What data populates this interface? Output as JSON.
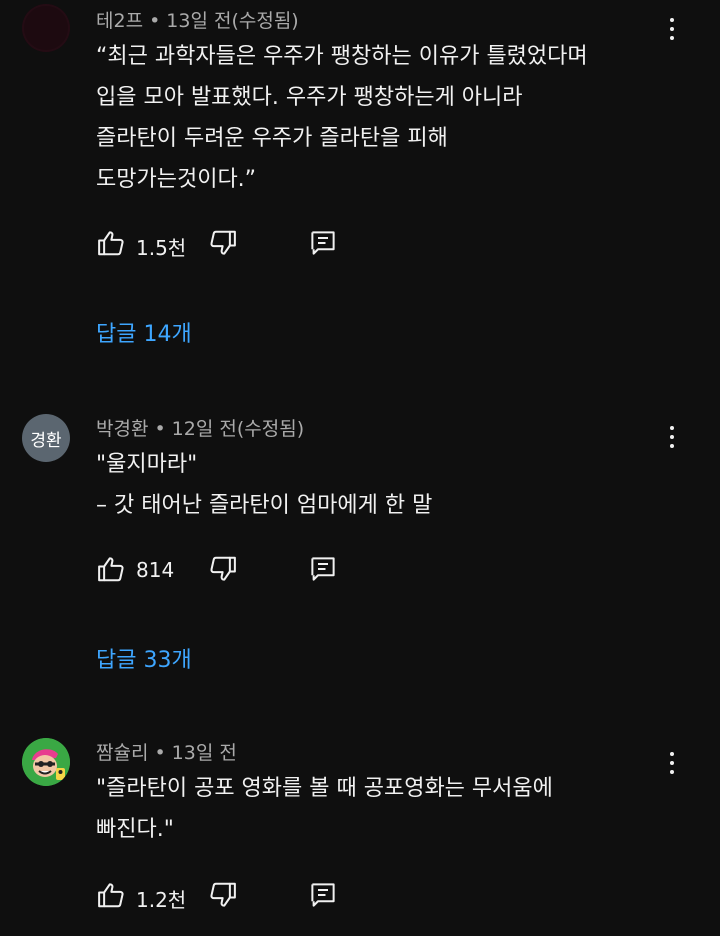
{
  "comments": [
    {
      "author": "테2프",
      "time": "13일 전(수정됨)",
      "text": "“최근 과학자들은 우주가 팽창하는 이유가 틀렸었다며\n입을 모아 발표했다. 우주가 팽창하는게 아니라\n즐라탄이 두려운 우주가 즐라탄을 피해\n도망가는것이다.”",
      "likes": "1.5천",
      "replies": "답글 14개"
    },
    {
      "author": "박경환",
      "avatar_initial": "경환",
      "time": "12일 전(수정됨)",
      "text": "\"울지마라\"\n– 갓 태어난 즐라탄이 엄마에게 한 말",
      "likes": "814",
      "replies": "답글 33개"
    },
    {
      "author": "짬슐리",
      "time": "13일 전",
      "text": "\"즐라탄이 공포 영화를 볼 때 공포영화는 무서움에\n빠진다.\"",
      "likes": "1.2천"
    }
  ],
  "meta_separator": "•",
  "colors": {
    "background": "#0f0f0f",
    "text": "#f1f1f1",
    "secondary": "#aaaaaa",
    "link": "#3ea6ff"
  },
  "icons": [
    "like-icon",
    "dislike-icon",
    "reply-icon",
    "more-options-icon"
  ]
}
